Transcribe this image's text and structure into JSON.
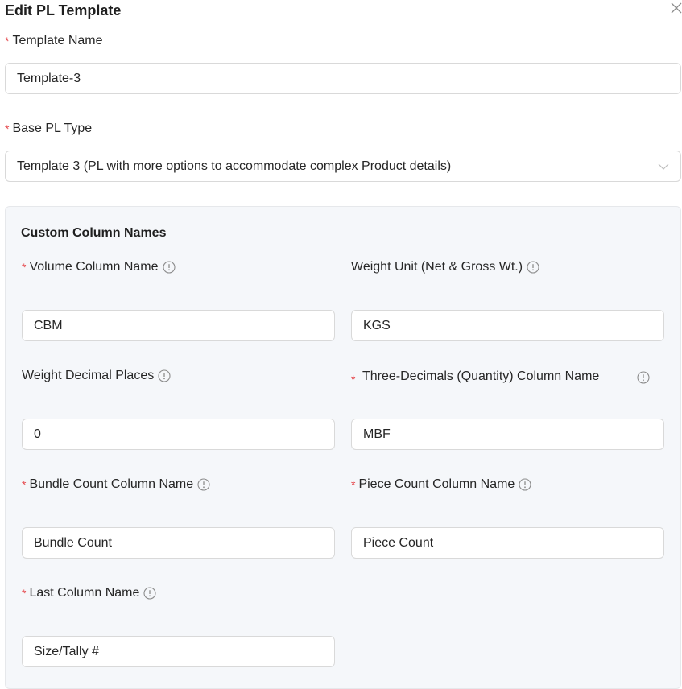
{
  "modal": {
    "title": "Edit PL Template"
  },
  "template_name": {
    "label": "Template Name",
    "value": "Template-3",
    "required": true
  },
  "base_pl_type": {
    "label": "Base PL Type",
    "value": "Template 3 (PL with more options to accommodate complex Product details)",
    "required": true
  },
  "custom_columns": {
    "title": "Custom Column Names",
    "volume": {
      "label": "Volume Column Name",
      "value": "CBM",
      "required": true
    },
    "weight_unit": {
      "label": "Weight Unit (Net & Gross Wt.)",
      "value": "KGS",
      "required": false
    },
    "weight_decimal": {
      "label": "Weight Decimal Places",
      "value": "0",
      "required": false
    },
    "three_decimals": {
      "label": "Three-Decimals (Quantity) Column Name",
      "value": "MBF",
      "required": true
    },
    "bundle_count": {
      "label": "Bundle Count Column Name",
      "value": "Bundle Count",
      "required": true
    },
    "piece_count": {
      "label": "Piece Count Column Name",
      "value": "Piece Count",
      "required": true
    },
    "last_column": {
      "label": "Last Column Name",
      "value": "Size/Tally #",
      "required": true
    }
  },
  "icons": {
    "close": "close-icon",
    "info": "info-circle-icon",
    "dropdown": "chevron-down-icon",
    "required": "asterisk"
  },
  "colors": {
    "required": "#e5484d",
    "border": "#d9d9d9",
    "panel_bg": "#f5f7fa",
    "text": "#262626"
  }
}
